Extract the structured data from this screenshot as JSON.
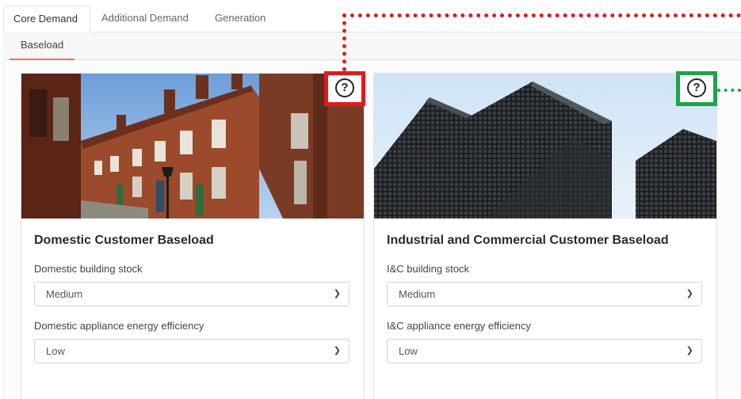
{
  "tabs": [
    {
      "label": "Core Demand",
      "active": true
    },
    {
      "label": "Additional Demand",
      "active": false
    },
    {
      "label": "Generation",
      "active": false
    }
  ],
  "subtabs": [
    {
      "label": "Baseload",
      "active": true
    }
  ],
  "cards": [
    {
      "title": "Domestic Customer Baseload",
      "fields": [
        {
          "label": "Domestic building stock",
          "value": "Medium"
        },
        {
          "label": "Domestic appliance energy efficiency",
          "value": "Low"
        }
      ]
    },
    {
      "title": "Industrial and Commercial Customer Baseload",
      "fields": [
        {
          "label": "I&C building stock",
          "value": "Medium"
        },
        {
          "label": "I&C appliance energy efficiency",
          "value": "Low"
        }
      ]
    }
  ],
  "help_icon_glyph": "?",
  "colors": {
    "accent_underline": "#e8764f",
    "highlight_red": "#e01b1b",
    "highlight_green": "#1da34a"
  },
  "icons": {
    "help": "question-circle-icon",
    "dropdown": "chevron-down-icon"
  }
}
